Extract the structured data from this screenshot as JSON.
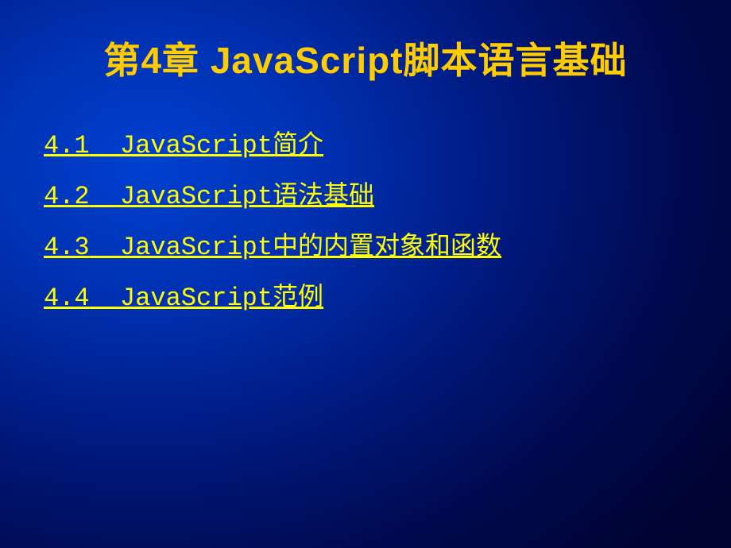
{
  "slide": {
    "title": "第4章 JavaScript脚本语言基础",
    "toc": [
      {
        "number": "4.1",
        "label": "JavaScript简介"
      },
      {
        "number": "4.2",
        "label": "JavaScript语法基础"
      },
      {
        "number": "4.3",
        "label": "JavaScript中的内置对象和函数"
      },
      {
        "number": "4.4",
        "label": "JavaScript范例"
      }
    ]
  }
}
